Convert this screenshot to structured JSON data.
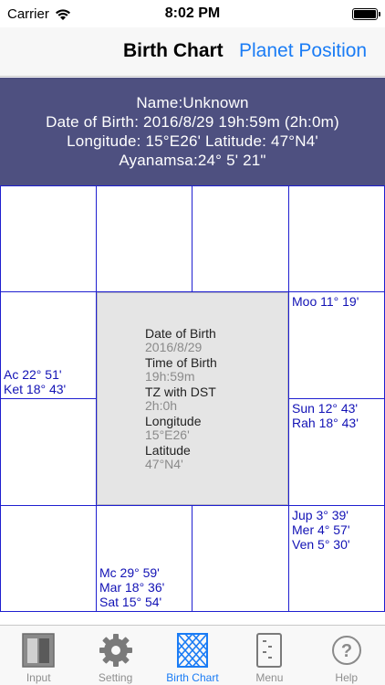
{
  "status": {
    "carrier": "Carrier",
    "time": "8:02 PM"
  },
  "nav": {
    "title": "Birth Chart",
    "link": "Planet Position"
  },
  "info": {
    "name": "Name:Unknown",
    "dob": "Date of Birth: 2016/8/29 19h:59m (2h:0m)",
    "coords": "Longitude: 15°E26' Latitude: 47°N4'",
    "ayanamsa": "Ayanamsa:24° 5' 21\""
  },
  "chart": {
    "cells": {
      "r1c4": [],
      "r2c4": [
        "Moo 11° 19'"
      ],
      "r3c4": [
        "Sun 12° 43'",
        "Rah 18° 43'"
      ],
      "r4c4": [
        "Jup 3° 39'",
        "Mer 4° 57'",
        "Ven 5° 30'"
      ],
      "r2c1": [
        "Ac 22° 51'",
        "Ket 18° 43'"
      ],
      "r4c2": [
        "Mc 29° 59'",
        "Mar 18° 36'",
        "Sat 15° 54'"
      ]
    },
    "center": {
      "dob_label": "Date of Birth",
      "dob_value": "2016/8/29",
      "tob_label": "Time of Birth",
      "tob_value": "19h:59m",
      "tz_label": "TZ with DST",
      "tz_value": "2h:0h",
      "lon_label": "Longitude",
      "lon_value": "15°E26'",
      "lat_label": "Latitude",
      "lat_value": "47°N4'"
    }
  },
  "tabs": [
    {
      "label": "Input",
      "icon": "input-icon"
    },
    {
      "label": "Setting",
      "icon": "gear-icon"
    },
    {
      "label": "Birth Chart",
      "icon": "birth-chart-icon",
      "active": true
    },
    {
      "label": "Menu",
      "icon": "menu-icon"
    },
    {
      "label": "Help",
      "icon": "help-icon"
    }
  ],
  "colors": {
    "accent": "#1a7cf5",
    "header_bg": "#4e5080",
    "planet_text": "#1212b5",
    "grid_line": "#1f1fd0"
  }
}
